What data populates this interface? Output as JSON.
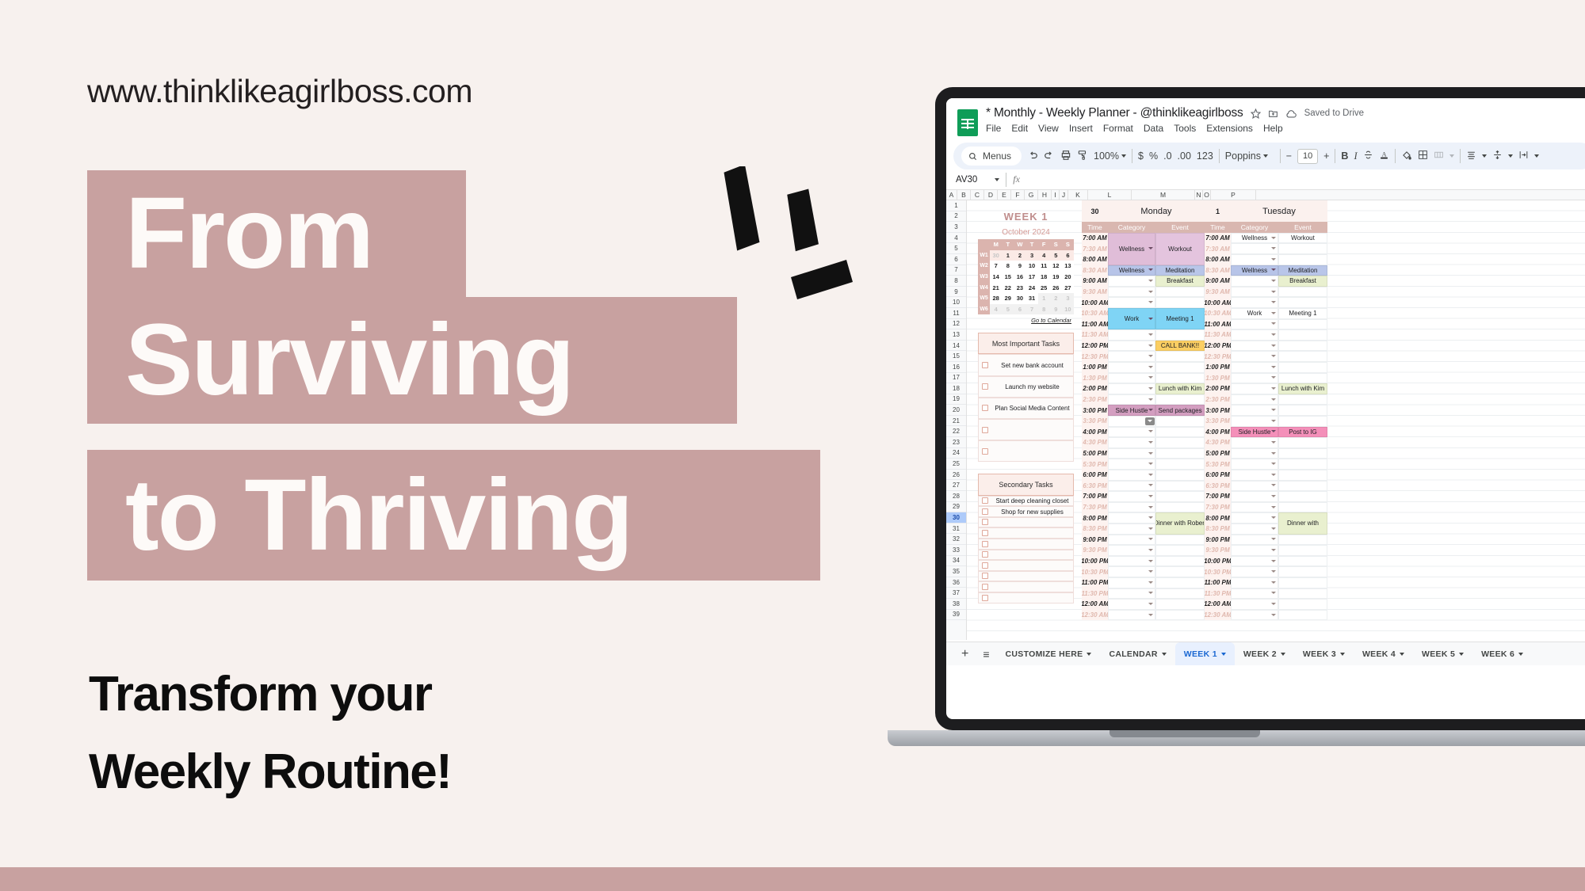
{
  "promo": {
    "site_url": "www.thinklikeagirlboss.com",
    "headline_lines": [
      "From",
      "Surviving",
      "to Thriving"
    ],
    "subhead_lines": [
      "Transform your",
      "Weekly Routine!"
    ],
    "band_color": "#c8a1a0",
    "headline_text_color": "#fdfaf8",
    "background_color": "#f7f1ee",
    "subhead_color": "#0d0d0d"
  },
  "sheet": {
    "title": "* Monthly - Weekly Planner - @thinklikeagirlboss",
    "save_status": "Saved to Drive",
    "menus": [
      "File",
      "Edit",
      "View",
      "Insert",
      "Format",
      "Data",
      "Tools",
      "Extensions",
      "Help"
    ],
    "toolbar": {
      "search_label": "Menus",
      "zoom": "100%",
      "currency": "$",
      "percent": "%",
      "dec_less": ".0",
      "dec_more": ".00",
      "number_format": "123",
      "font": "Poppins",
      "font_size": "10",
      "bold": "B",
      "italic": "I"
    },
    "namebox": "AV30",
    "formula_value": "",
    "col_headers": [
      "A",
      "B",
      "C",
      "D",
      "E",
      "F",
      "G",
      "H",
      "I",
      "J",
      "K",
      "L",
      "M",
      "N",
      "O",
      "P"
    ],
    "row_count": 39,
    "selected_row": 30,
    "tabs": {
      "add": "+",
      "all_sheets": "≡",
      "items": [
        {
          "label": "CUSTOMIZE HERE",
          "active": false
        },
        {
          "label": "CALENDAR",
          "active": false
        },
        {
          "label": "WEEK 1",
          "active": true
        },
        {
          "label": "WEEK 2",
          "active": false
        },
        {
          "label": "WEEK 3",
          "active": false
        },
        {
          "label": "WEEK 4",
          "active": false
        },
        {
          "label": "WEEK 5",
          "active": false
        },
        {
          "label": "WEEK 6",
          "active": false
        }
      ]
    }
  },
  "planner": {
    "week_title": "WEEK 1",
    "month_title": "October 2024",
    "calendar": {
      "weekday_headers": [
        "M",
        "T",
        "W",
        "T",
        "F",
        "S",
        "S"
      ],
      "week_labels": [
        "W1",
        "W2",
        "W3",
        "W4",
        "W5",
        "W6"
      ],
      "rows": [
        [
          "30",
          "1",
          "2",
          "3",
          "4",
          "5",
          "6"
        ],
        [
          "7",
          "8",
          "9",
          "10",
          "11",
          "12",
          "13"
        ],
        [
          "14",
          "15",
          "16",
          "17",
          "18",
          "19",
          "20"
        ],
        [
          "21",
          "22",
          "23",
          "24",
          "25",
          "26",
          "27"
        ],
        [
          "28",
          "29",
          "30",
          "31",
          "1",
          "2",
          "3"
        ],
        [
          "4",
          "5",
          "6",
          "7",
          "8",
          "9",
          "10"
        ]
      ],
      "muted_cells": [
        "0-0",
        "4-4",
        "4-5",
        "4-6",
        "5-0",
        "5-1",
        "5-2",
        "5-3",
        "5-4",
        "5-5",
        "5-6"
      ],
      "link_label": "Go to Calendar"
    },
    "most_important_tasks": {
      "header": "Most Important Tasks",
      "items": [
        "Set new bank account",
        "Launch my website",
        "Plan Social Media Content",
        "",
        ""
      ]
    },
    "secondary_tasks": {
      "header": "Secondary Tasks",
      "items": [
        "Start deep cleaning closet",
        "Shop for new supplies",
        "",
        "",
        "",
        "",
        "",
        "",
        "",
        ""
      ]
    },
    "column_headers": [
      "Time",
      "Category",
      "Event"
    ],
    "times": [
      "7:00 AM",
      "7:30 AM",
      "8:00 AM",
      "8:30 AM",
      "9:00 AM",
      "9:30 AM",
      "10:00 AM",
      "10:30 AM",
      "11:00 AM",
      "11:30 AM",
      "12:00 PM",
      "12:30 PM",
      "1:00 PM",
      "1:30 PM",
      "2:00 PM",
      "2:30 PM",
      "3:00 PM",
      "3:30 PM",
      "4:00 PM",
      "4:30 PM",
      "5:00 PM",
      "5:30 PM",
      "6:00 PM",
      "6:30 PM",
      "7:00 PM",
      "7:30 PM",
      "8:00 PM",
      "8:30 PM",
      "9:00 PM",
      "9:30 PM",
      "10:00 PM",
      "10:30 PM",
      "11:00 PM",
      "11:30 PM",
      "12:00 AM",
      "12:30 AM"
    ],
    "days": [
      {
        "date": "30",
        "name": "Monday",
        "entries": [
          {
            "start": 0,
            "span": 3,
            "category": "Wellness",
            "event": "Workout",
            "cat_color": "#e0bdd8",
            "evt_color": "#e4c4de"
          },
          {
            "start": 3,
            "span": 1,
            "category": "Wellness",
            "event": "Meditation",
            "cat_color": "#b7c4e8",
            "evt_color": "#b9c6e9"
          },
          {
            "start": 4,
            "span": 1,
            "category": "",
            "event": "Breakfast",
            "cat_color": "",
            "evt_color": "#e9f0cf"
          },
          {
            "start": 7,
            "span": 2,
            "category": "Work",
            "event": "Meeting 1",
            "cat_color": "#7fd4f5",
            "evt_color": "#7fd4f5"
          },
          {
            "start": 10,
            "span": 1,
            "category": "",
            "event": "CALL BANK!!",
            "cat_color": "",
            "evt_color": "#fbce62"
          },
          {
            "start": 14,
            "span": 1,
            "category": "",
            "event": "Lunch with Kim",
            "cat_color": "",
            "evt_color": "#e9f0cf"
          },
          {
            "start": 16,
            "span": 1,
            "category": "Side Hustle",
            "event": "Send packages",
            "cat_color": "#d39ec0",
            "evt_color": "#d39ec0"
          },
          {
            "start": 26,
            "span": 2,
            "category": "",
            "event": "Dinner with Robert",
            "cat_color": "",
            "evt_color": "#e9f0cf"
          }
        ]
      },
      {
        "date": "1",
        "name": "Tuesday",
        "entries": [
          {
            "start": 0,
            "span": 1,
            "category": "Wellness",
            "event": "Workout",
            "cat_color": "",
            "evt_color": ""
          },
          {
            "start": 3,
            "span": 1,
            "category": "Wellness",
            "event": "Meditation",
            "cat_color": "#b7c4e8",
            "evt_color": "#b9c6e9"
          },
          {
            "start": 4,
            "span": 1,
            "category": "",
            "event": "Breakfast",
            "cat_color": "",
            "evt_color": "#e9f0cf"
          },
          {
            "start": 7,
            "span": 1,
            "category": "Work",
            "event": "Meeting 1",
            "cat_color": "",
            "evt_color": ""
          },
          {
            "start": 14,
            "span": 1,
            "category": "",
            "event": "Lunch with Kim",
            "cat_color": "",
            "evt_color": "#e9f0cf"
          },
          {
            "start": 18,
            "span": 1,
            "category": "Side Hustle",
            "event": "Post to IG",
            "cat_color": "#f48fb9",
            "evt_color": "#f48fb9"
          },
          {
            "start": 26,
            "span": 2,
            "category": "",
            "event": "Dinner with",
            "cat_color": "",
            "evt_color": "#e9f0cf"
          }
        ]
      }
    ]
  }
}
